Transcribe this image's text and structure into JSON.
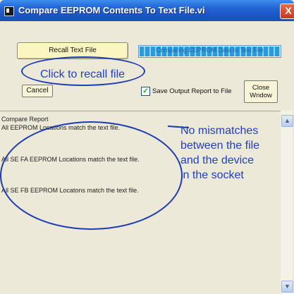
{
  "window": {
    "title": "Compare EEPROM Contents To Text File.vi",
    "close_label": "X"
  },
  "controls": {
    "recall_label": "Recall Text File",
    "cancel_label": "Cancel",
    "save_checkbox_checked": true,
    "save_checkbox_label": "Save Output Report to File",
    "close_window_line1": "Close",
    "close_window_line2": "Wndow"
  },
  "progress": {
    "text": "Comparing EEPROM Data to Text File",
    "fill_fraction": 1.0
  },
  "annotations": {
    "recall_note": "Click to recall file",
    "report_note_lines": [
      "No mismatches",
      "between the file",
      "and the device",
      "in the socket"
    ]
  },
  "report": {
    "heading": "Compare Report",
    "lines": [
      "All EEPROM Locations match the text file.",
      "All SE FA EEPROM Locations match the text file.",
      "All SE FB EEPROM Locatons match the text file."
    ]
  },
  "scrollbar": {
    "up_arrow": "▲",
    "down_arrow": "▼"
  },
  "colors": {
    "titlebar": "#2466d6",
    "annotation_blue": "#1f3fc6",
    "recall_button": "#fbf5c2",
    "progress_blue": "#2a9ad8"
  }
}
